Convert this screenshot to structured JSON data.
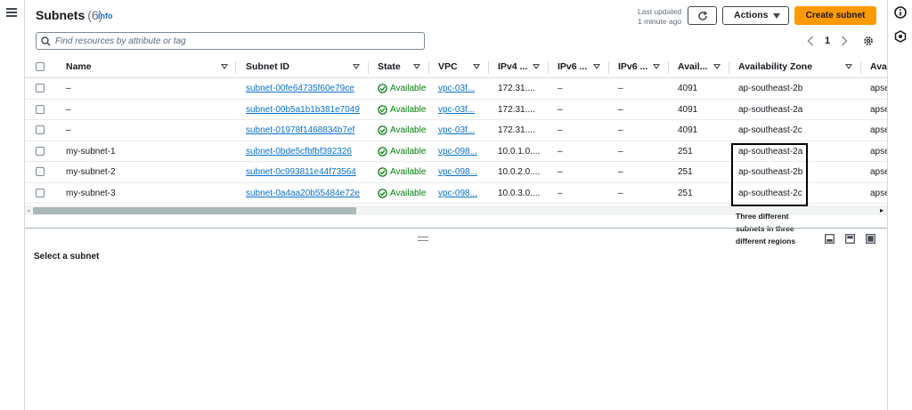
{
  "header": {
    "title": "Subnets",
    "count": "(6)",
    "info_label": "Info",
    "last_updated_line1": "Last updated",
    "last_updated_line2": "1 minute ago",
    "actions_label": "Actions",
    "create_label": "Create subnet"
  },
  "search": {
    "placeholder": "Find resources by attribute or tag"
  },
  "pagination": {
    "current_page": "1"
  },
  "table": {
    "columns": [
      "Name",
      "Subnet ID",
      "State",
      "VPC",
      "IPv4 ...",
      "IPv6 ...",
      "IPv6 ...",
      "Avail...",
      "Availability Zone",
      "Avai"
    ],
    "rows": [
      {
        "name": "–",
        "subnet_id": "subnet-00fe64735f60e79ce",
        "state": "Available",
        "vpc": "vpc-03f...",
        "ipv4": "172.31....",
        "ipv6a": "–",
        "ipv6b": "–",
        "available_ips": "4091",
        "az": "ap-southeast-2b",
        "az_id": "apse"
      },
      {
        "name": "–",
        "subnet_id": "subnet-00b5a1b1b381e7049",
        "state": "Available",
        "vpc": "vpc-03f...",
        "ipv4": "172.31....",
        "ipv6a": "–",
        "ipv6b": "–",
        "available_ips": "4091",
        "az": "ap-southeast-2a",
        "az_id": "apse"
      },
      {
        "name": "–",
        "subnet_id": "subnet-01978f1468834b7ef",
        "state": "Available",
        "vpc": "vpc-03f...",
        "ipv4": "172.31....",
        "ipv6a": "–",
        "ipv6b": "–",
        "available_ips": "4091",
        "az": "ap-southeast-2c",
        "az_id": "apse"
      },
      {
        "name": "my-subnet-1",
        "subnet_id": "subnet-0bde5cfbfbf392326",
        "state": "Available",
        "vpc": "vpc-098...",
        "ipv4": "10.0.1.0....",
        "ipv6a": "–",
        "ipv6b": "–",
        "available_ips": "251",
        "az": "ap-southeast-2a",
        "az_id": "apse"
      },
      {
        "name": "my-subnet-2",
        "subnet_id": "subnet-0c993811e44f73564",
        "state": "Available",
        "vpc": "vpc-098...",
        "ipv4": "10.0.2.0....",
        "ipv6a": "–",
        "ipv6b": "–",
        "available_ips": "251",
        "az": "ap-southeast-2b",
        "az_id": "apse"
      },
      {
        "name": "my-subnet-3",
        "subnet_id": "subnet-0a4aa20b55484e72e",
        "state": "Available",
        "vpc": "vpc-098...",
        "ipv4": "10.0.3.0....",
        "ipv6a": "–",
        "ipv6b": "–",
        "available_ips": "251",
        "az": "ap-southeast-2c",
        "az_id": "apse"
      }
    ]
  },
  "annotation": {
    "line1": "Three different",
    "line2": "subnets in three",
    "line3": "different regions"
  },
  "detail": {
    "title": "Select a subnet"
  },
  "colors": {
    "accent": "#0972d3",
    "primary_button": "#ff9900",
    "status_success": "#037f0c"
  }
}
